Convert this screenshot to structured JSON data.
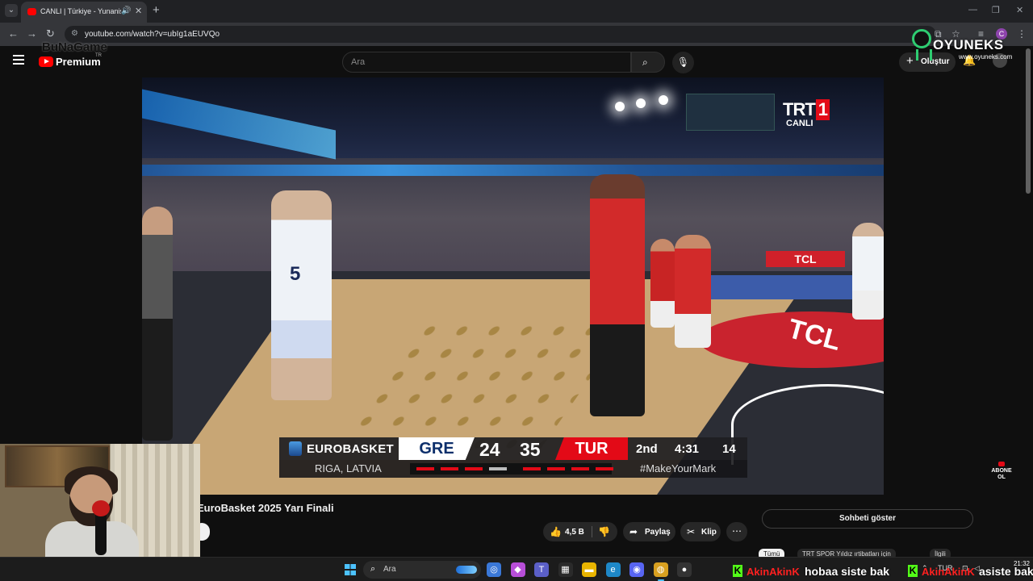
{
  "browser": {
    "tab_title": "CANLI | Türkiye - Yunanistan",
    "audio_icon": "🔊",
    "close_icon": "✕",
    "new_tab_icon": "+",
    "url": "youtube.com/watch?v=ubIg1aEUVQo",
    "back_icon": "←",
    "forward_icon": "→",
    "reload_icon": "↻",
    "profile_initial": "C",
    "minimize_icon": "—",
    "maximize_icon": "❐",
    "win_close_icon": "✕"
  },
  "youtube": {
    "logo_text": "Premium",
    "country_code": "TR",
    "search_placeholder": "Ara",
    "search_icon": "⌕",
    "mic_icon": "🎙",
    "create_label": "Oluştur",
    "create_icon": "+",
    "bell_icon": "🔔"
  },
  "watermarks": {
    "left_logo": "BuNaGame",
    "oyuneks_name": "OYUNEKS",
    "oyuneks_url": "www.oyuneks.com",
    "subscribe_text_1": "ABONE",
    "subscribe_text_2": "OL"
  },
  "broadcast": {
    "channel": "TRT",
    "channel_num": "1",
    "live_label": "CANLI",
    "court_ad": "TCL",
    "court_logo": "TCL",
    "jersey_number": "5"
  },
  "scorebug": {
    "competition": "EUROBASKET",
    "location": "RIGA, LATVIA",
    "home_team": "GRE",
    "home_score": "24",
    "away_score": "35",
    "away_team": "TUR",
    "period": "2nd",
    "game_clock": "4:31",
    "shot_clock": "14",
    "hashtag": "#MakeYourMark",
    "colors": {
      "home": "#ffffff",
      "away": "#e30a17",
      "foul_on": "#e30a17",
      "foul_off": "#bbbbbb"
    },
    "home_fouls": [
      true,
      true,
      true,
      false
    ],
    "away_fouls": [
      true,
      true,
      true,
      true
    ]
  },
  "video": {
    "title": "EuroBasket 2025 Yarı Finali",
    "like_count": "4,5 B",
    "like_icon": "👍",
    "dislike_icon": "👎",
    "share_label": "Paylaş",
    "share_icon": "➦",
    "clip_label": "Klip",
    "clip_icon": "✂",
    "more_icon": "⋯",
    "show_chat_label": "Sohbeti göster",
    "chips": [
      "Tümü",
      "TRT SPOR Yıldız ırtibatları için",
      "İlgili"
    ]
  },
  "taskbar": {
    "search_placeholder": "Ara",
    "search_icon": "⌕",
    "tray_lang": "TUR",
    "time": "21:32",
    "apps": [
      {
        "name": "copilot-icon",
        "glyph": "◎",
        "color": "#3a78d8"
      },
      {
        "name": "colorful-app-icon",
        "glyph": "◆",
        "color": "#b84ed8"
      },
      {
        "name": "teams-icon",
        "glyph": "T",
        "color": "#5b5fc7"
      },
      {
        "name": "store-icon",
        "glyph": "▦",
        "color": "#2a2a2a"
      },
      {
        "name": "file-explorer-icon",
        "glyph": "▬",
        "color": "#e8b400"
      },
      {
        "name": "edge-icon",
        "glyph": "e",
        "color": "#1e88c8"
      },
      {
        "name": "discord-icon",
        "glyph": "◉",
        "color": "#5865f2"
      },
      {
        "name": "chrome-icon",
        "glyph": "◍",
        "color": "#d8a020"
      },
      {
        "name": "obs-icon",
        "glyph": "●",
        "color": "#333333"
      }
    ]
  },
  "chat_ticker": {
    "user": "AkinAkinK",
    "message": "hobaa siste bak",
    "user_2": "AkinAkinK",
    "message_2": "asiste bak",
    "platform_letter": "K"
  }
}
